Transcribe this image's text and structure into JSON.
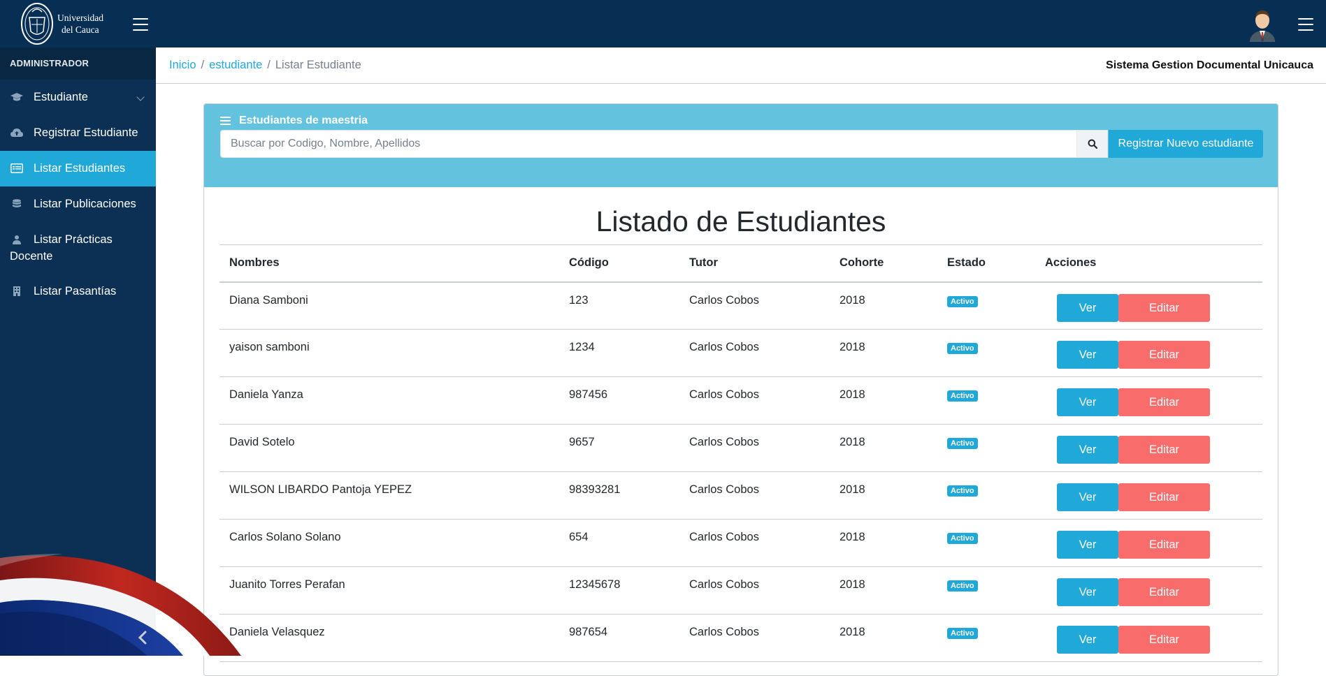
{
  "header": {
    "logo_line1": "Universidad",
    "logo_line2": "del Cauca"
  },
  "sidebar": {
    "title": "ADMINISTRADOR",
    "items": [
      {
        "label": "Estudiante",
        "icon": "graduation-cap-icon"
      },
      {
        "label": "Registrar Estudiante",
        "icon": "cloud-upload-icon"
      },
      {
        "label": "Listar Estudiantes",
        "icon": "list-card-icon"
      },
      {
        "label": "Listar Publicaciones",
        "icon": "database-icon"
      },
      {
        "label": "Listar Prácticas Docente",
        "icon": "teacher-icon"
      },
      {
        "label": "Listar Pasantías",
        "icon": "building-icon"
      }
    ],
    "active_index": 2
  },
  "breadcrumb": {
    "home": "Inicio",
    "section": "estudiante",
    "current": "Listar Estudiante",
    "separator": "/"
  },
  "system_name": "Sistema Gestion Documental Unicauca",
  "card": {
    "title": "Estudiantes de maestria",
    "search_placeholder": "Buscar por Codigo, Nombre, Apellidos",
    "register_button": "Registrar Nuevo estudiante"
  },
  "list": {
    "heading": "Listado de Estudiantes",
    "columns": [
      "Nombres",
      "Código",
      "Tutor",
      "Cohorte",
      "Estado",
      "Acciones"
    ],
    "rows": [
      {
        "name": "Diana Samboni",
        "code": "123",
        "tutor": "Carlos Cobos",
        "cohort": "2018",
        "status": "Activo"
      },
      {
        "name": "yaison samboni",
        "code": "1234",
        "tutor": "Carlos Cobos",
        "cohort": "2018",
        "status": "Activo"
      },
      {
        "name": "Daniela Yanza",
        "code": "987456",
        "tutor": "Carlos Cobos",
        "cohort": "2018",
        "status": "Activo"
      },
      {
        "name": "David Sotelo",
        "code": "9657",
        "tutor": "Carlos Cobos",
        "cohort": "2018",
        "status": "Activo"
      },
      {
        "name": "WILSON LIBARDO Pantoja YEPEZ",
        "code": "98393281",
        "tutor": "Carlos Cobos",
        "cohort": "2018",
        "status": "Activo"
      },
      {
        "name": "Carlos Solano Solano",
        "code": "654",
        "tutor": "Carlos Cobos",
        "cohort": "2018",
        "status": "Activo"
      },
      {
        "name": "Juanito Torres Perafan",
        "code": "12345678",
        "tutor": "Carlos Cobos",
        "cohort": "2018",
        "status": "Activo"
      },
      {
        "name": "Daniela Velasquez",
        "code": "987654",
        "tutor": "Carlos Cobos",
        "cohort": "2018",
        "status": "Activo"
      }
    ],
    "view_label": "Ver",
    "edit_label": "Editar"
  },
  "colors": {
    "topbar": "#072f54",
    "sidebar": "#0b3053",
    "primary": "#20a8d8",
    "card_header": "#63c2de",
    "danger": "#f86c6b"
  }
}
